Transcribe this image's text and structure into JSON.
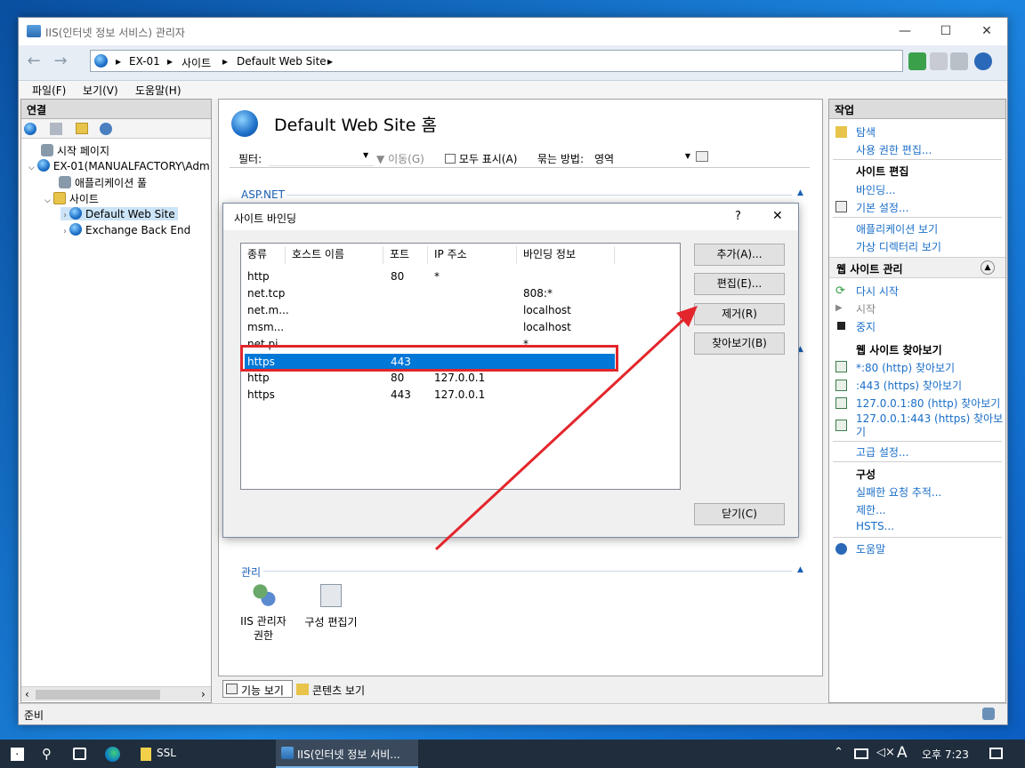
{
  "window": {
    "title": "IIS(인터넷 정보 서비스) 관리자",
    "minimize": "—",
    "maximize": "☐",
    "close": "✕"
  },
  "address": {
    "crumbs": [
      "EX-01",
      "사이트",
      "Default Web Site"
    ],
    "sep": "▸"
  },
  "menu": [
    "파일(F)",
    "보기(V)",
    "도움말(H)"
  ],
  "connections": {
    "header": "연결",
    "tree": [
      {
        "label": "시작 페이지"
      },
      {
        "label": "EX-01(MANUALFACTORY\\Adm"
      },
      {
        "label": "애플리케이션 풀"
      },
      {
        "label": "사이트"
      },
      {
        "label": "Default Web Site"
      },
      {
        "label": "Exchange Back End"
      }
    ]
  },
  "center": {
    "title": "Default Web Site 홈",
    "filter_label": "필터:",
    "go_label": "이동(G)",
    "show_all_label": "모두 표시(A)",
    "group_label": "묶는 방법:",
    "group_value": "영역",
    "section_aspnet": "ASP.NET",
    "section_manage": "관리",
    "manage_items": [
      {
        "label": "IIS 관리자 권한"
      },
      {
        "label": "구성 편집기"
      }
    ],
    "tab_features": "기능 보기",
    "tab_content": "콘텐츠 보기"
  },
  "dialog": {
    "title": "사이트 바인딩",
    "help": "?",
    "close": "✕",
    "columns": [
      "종류",
      "호스트 이름",
      "포트",
      "IP 주소",
      "바인딩 정보"
    ],
    "rows": [
      {
        "type": "http",
        "host": "",
        "port": "80",
        "ip": "*",
        "info": ""
      },
      {
        "type": "net.tcp",
        "host": "",
        "port": "",
        "ip": "",
        "info": "808:*"
      },
      {
        "type": "net.m...",
        "host": "",
        "port": "",
        "ip": "",
        "info": "localhost"
      },
      {
        "type": "msm...",
        "host": "",
        "port": "",
        "ip": "",
        "info": "localhost"
      },
      {
        "type": "net.pi...",
        "host": "",
        "port": "",
        "ip": "",
        "info": "*"
      },
      {
        "type": "https",
        "host": "",
        "port": "443",
        "ip": "",
        "info": ""
      },
      {
        "type": "http",
        "host": "",
        "port": "80",
        "ip": "127.0.0.1",
        "info": ""
      },
      {
        "type": "https",
        "host": "",
        "port": "443",
        "ip": "127.0.0.1",
        "info": ""
      }
    ],
    "selected_row": 5,
    "buttons": {
      "add": "추가(A)...",
      "edit": "편집(E)...",
      "remove": "제거(R)",
      "browse": "찾아보기(B)",
      "close": "닫기(C)"
    }
  },
  "actions": {
    "header": "작업",
    "explore": "탐색",
    "edit_perms": "사용 권한 편집...",
    "edit_site_h": "사이트 편집",
    "bindings": "바인딩...",
    "basic": "기본 설정...",
    "view_apps": "애플리케이션 보기",
    "view_vdirs": "가상 디렉터리 보기",
    "manage_h": "웹 사이트 관리",
    "restart": "다시 시작",
    "start": "시작",
    "stop": "중지",
    "browse_h": "웹 사이트 찾아보기",
    "browse1": "*:80 (http) 찾아보기",
    "browse2": ":443 (https) 찾아보기",
    "browse3": "127.0.0.1:80 (http) 찾아보기",
    "browse4a": "127.0.0.1:443 (https) 찾아보",
    "browse4b": "기",
    "advanced": "고급 설정...",
    "config_h": "구성",
    "failed": "실패한 요청 추적...",
    "limits": "제한...",
    "hsts": "HSTS...",
    "help": "도움말"
  },
  "status": {
    "text": "준비"
  },
  "taskbar": {
    "item_ssl": "SSL",
    "item_iis": "IIS(인터넷 정보 서비...",
    "lang": "A",
    "time": "오후 7:23"
  },
  "colors": {
    "selection": "#0078d7",
    "highlight_box": "#e3262c",
    "link": "#1a6ec8",
    "taskbar": "#1f2d3d"
  }
}
